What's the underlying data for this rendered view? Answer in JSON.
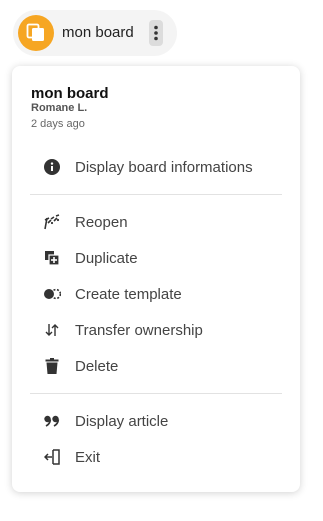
{
  "board": {
    "name": "mon board"
  },
  "menu": {
    "title": "mon board",
    "author": "Romane L.",
    "date": "2 days ago",
    "items": [
      {
        "label": "Display board informations",
        "icon": "info-icon"
      },
      {
        "label": "Reopen",
        "icon": "reopen-icon"
      },
      {
        "label": "Duplicate",
        "icon": "duplicate-icon"
      },
      {
        "label": "Create template",
        "icon": "template-icon"
      },
      {
        "label": "Transfer ownership",
        "icon": "transfer-icon"
      },
      {
        "label": "Delete",
        "icon": "trash-icon"
      },
      {
        "label": "Display article",
        "icon": "quote-icon"
      },
      {
        "label": "Exit",
        "icon": "exit-icon"
      }
    ]
  },
  "colors": {
    "accent": "#f6a623",
    "icon": "#333333",
    "text": "#444444"
  }
}
